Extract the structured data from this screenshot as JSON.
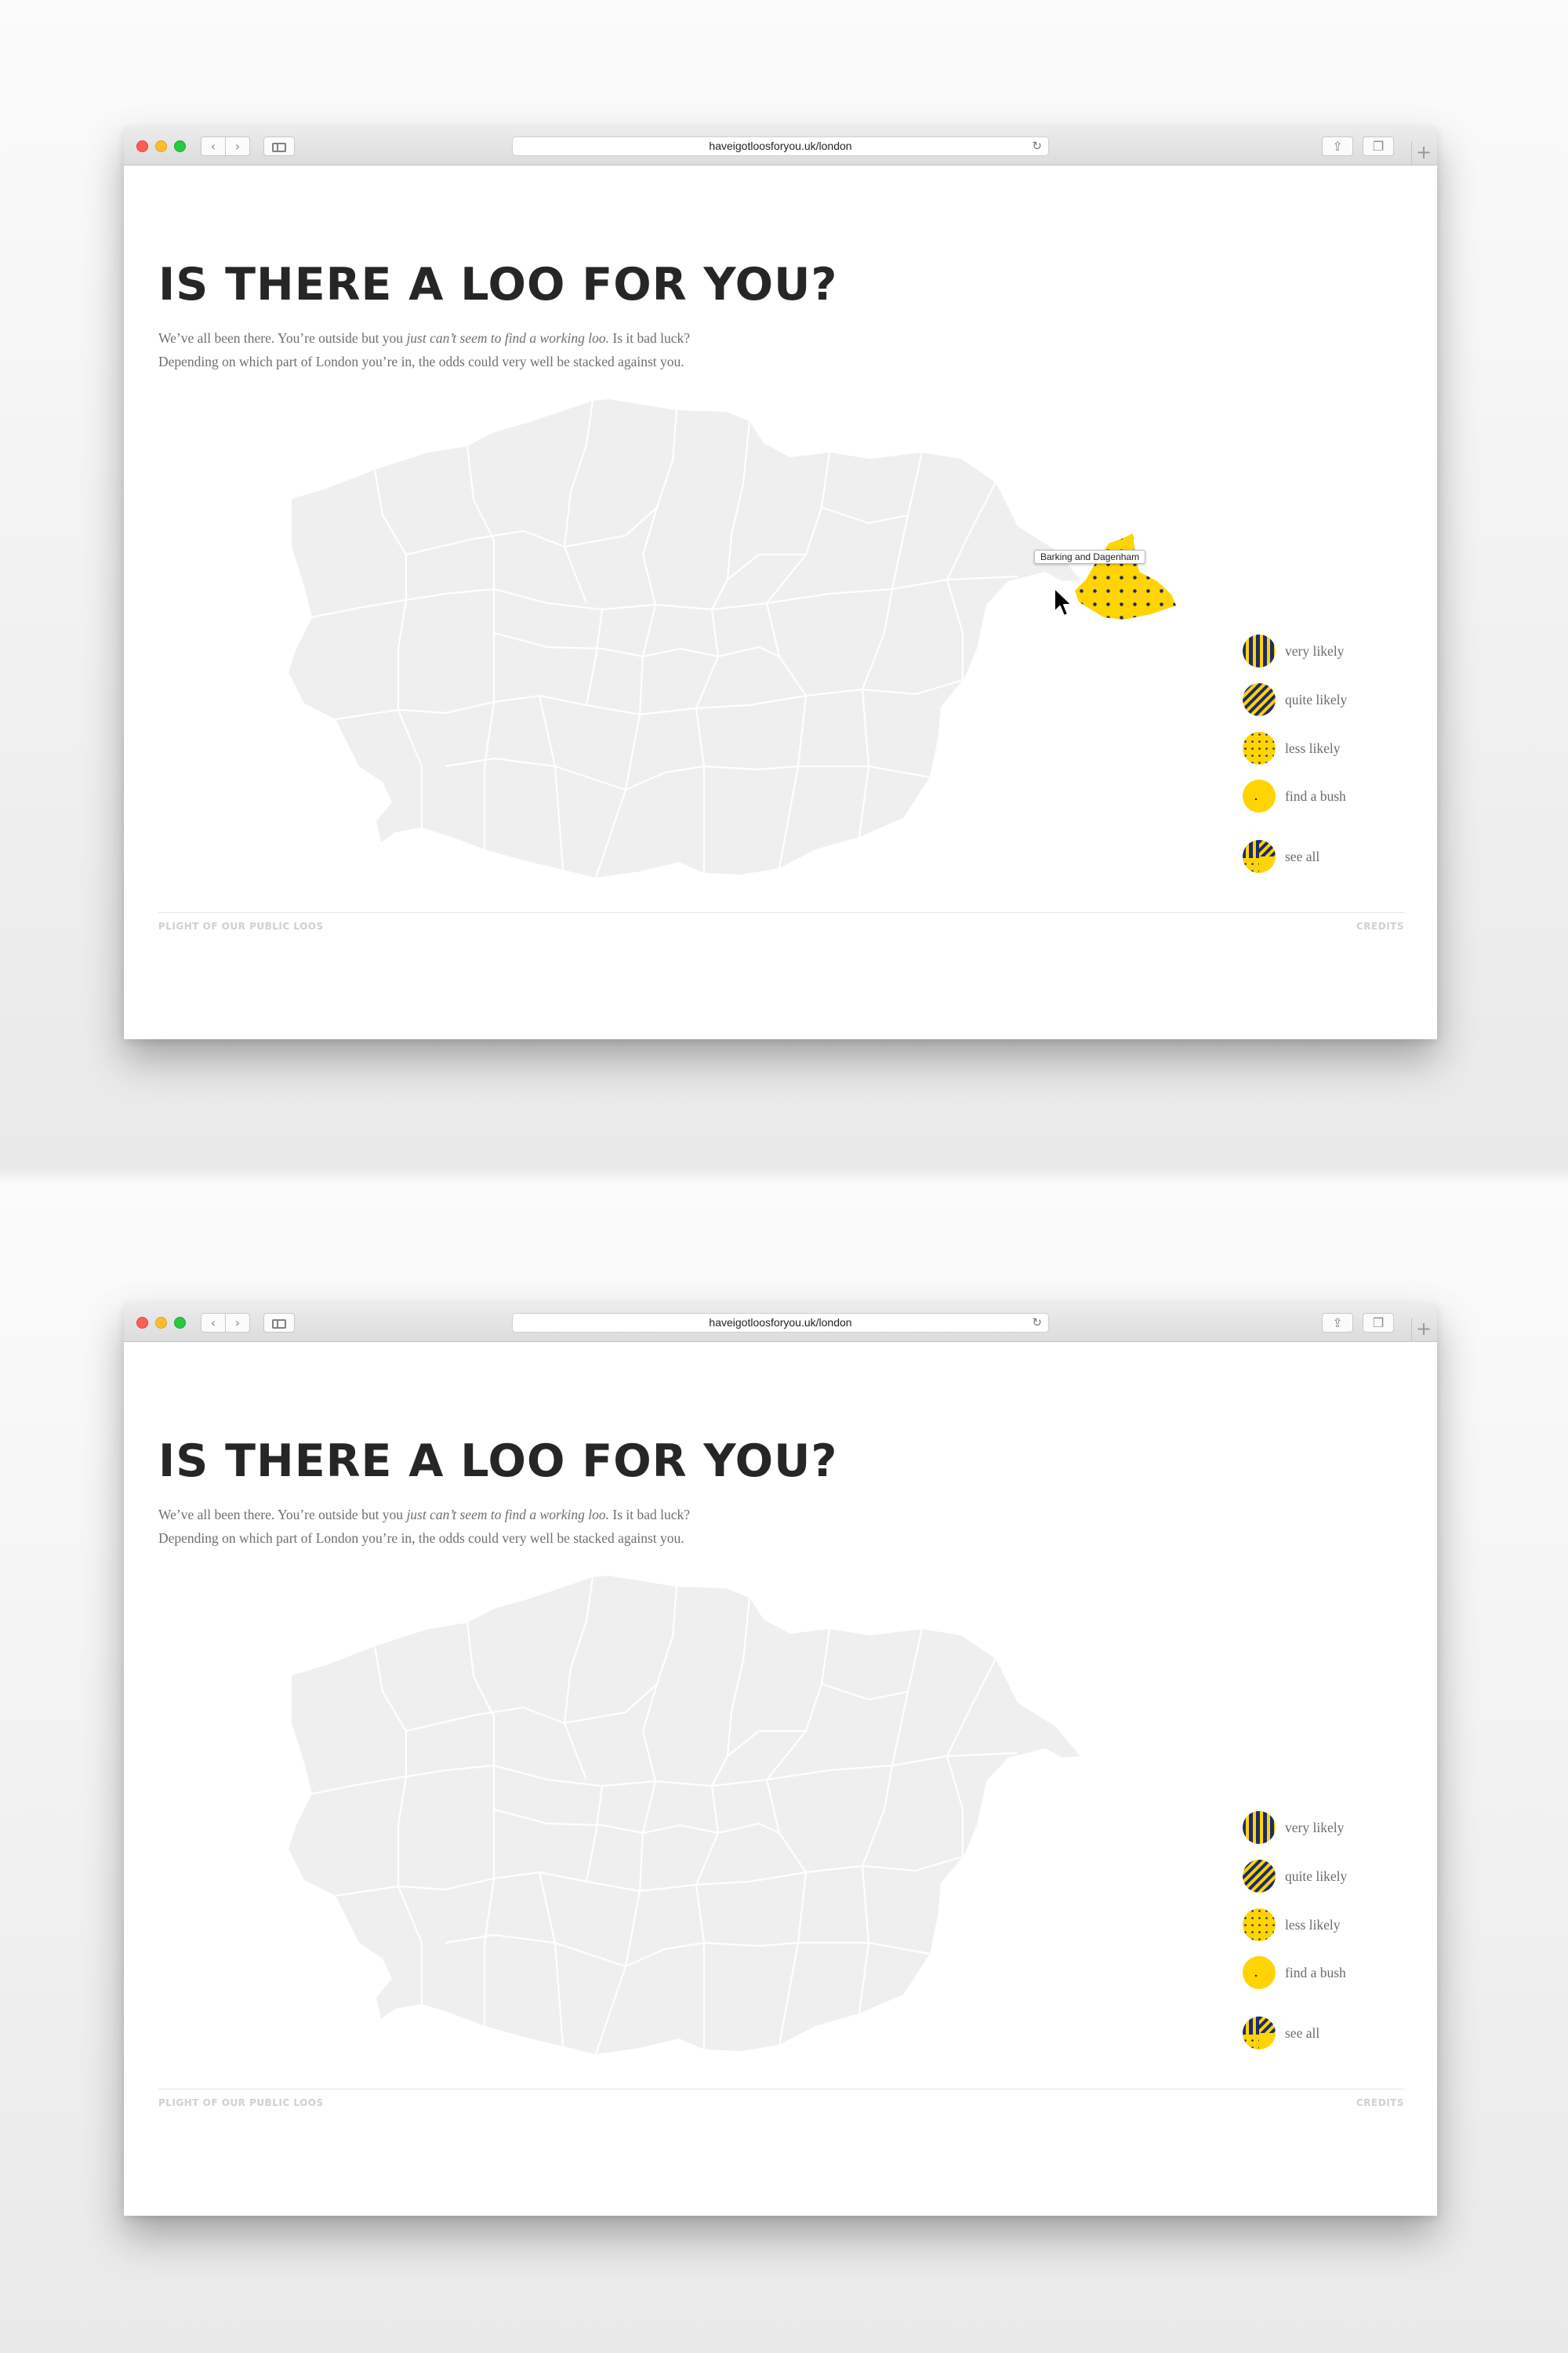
{
  "browser": {
    "url": "haveigotloosforyou.uk/london",
    "back_glyph": "‹",
    "forward_glyph": "›",
    "reload_glyph": "↻",
    "new_tab_glyph": "+",
    "share_glyph": "⇪",
    "tabs_glyph": "❐"
  },
  "page": {
    "title": "IS THERE A LOO FOR YOU?",
    "intro_part1": "We’ve all been there. You’re outside but you ",
    "intro_emphasis": "just can’t seem to find a working loo.",
    "intro_part2": " Is it bad luck?",
    "intro_line2": "Depending on which part of London you’re in, the odds could very well be stacked against you."
  },
  "map": {
    "region_color": "#efefef",
    "border_color": "#ffffff",
    "highlight_color": "#ffd400",
    "dot_color": "#1d2a6b",
    "hover_region": "Barking and Dagenham",
    "tooltip": "Barking and Dagenham"
  },
  "legend": {
    "items": [
      {
        "label": "very likely",
        "pattern": "vertical-stripes"
      },
      {
        "label": "quite likely",
        "pattern": "diagonal-stripes"
      },
      {
        "label": "less likely",
        "pattern": "dots"
      },
      {
        "label": "find a bush",
        "pattern": "plain-yellow"
      },
      {
        "label": "see all",
        "pattern": "mixed"
      }
    ]
  },
  "footer": {
    "left": "PLIGHT OF OUR PUBLIC LOOS",
    "right": "CREDITS"
  },
  "colors": {
    "yellow": "#ffd400",
    "navy": "#1d2a6b",
    "title": "#262626"
  }
}
